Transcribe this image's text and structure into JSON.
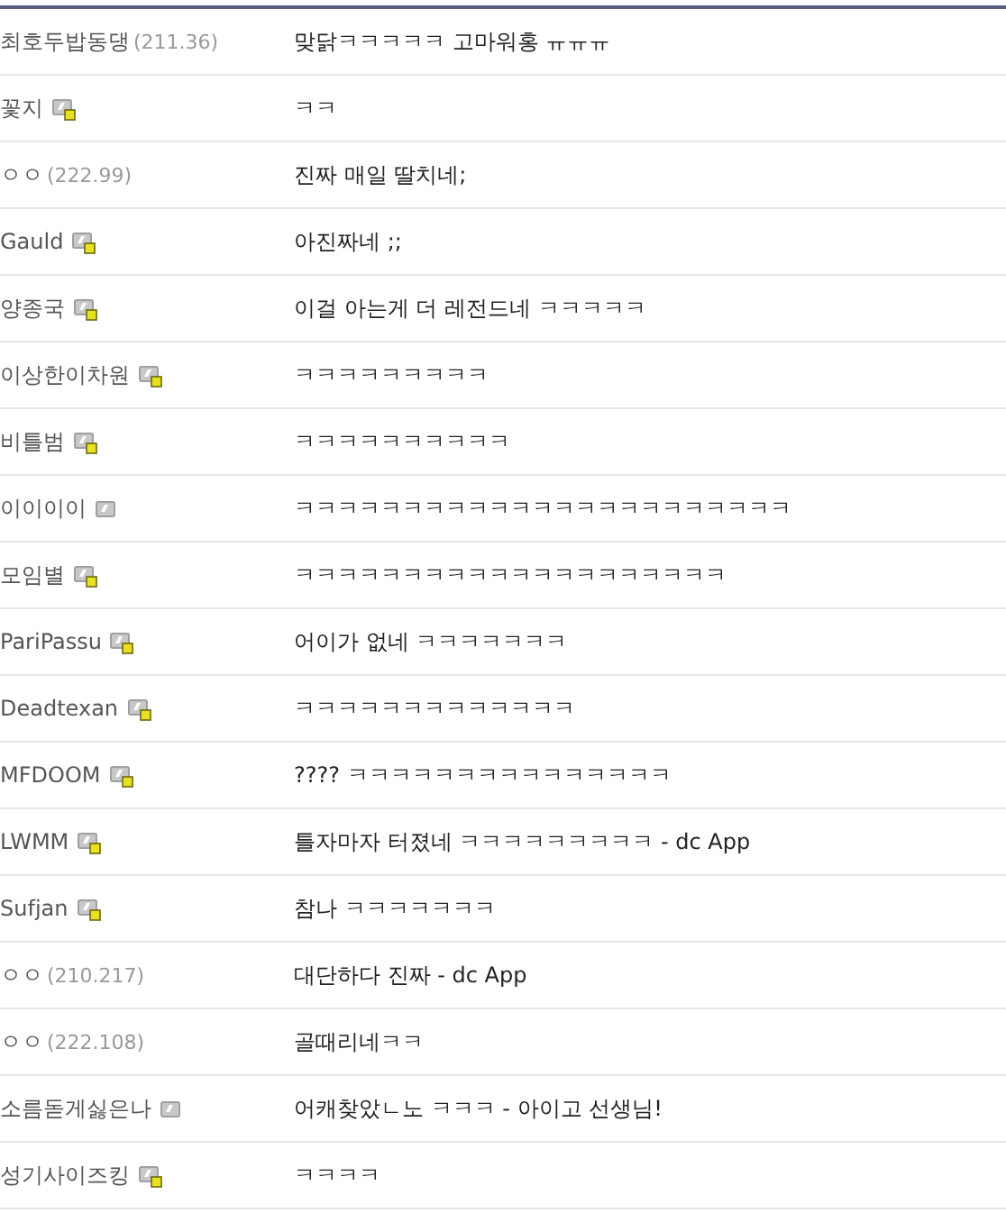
{
  "comments": [
    {
      "kind": "guest",
      "name": "최호두밥동댕",
      "ip": "(211.36)",
      "text": "맞닭ㅋㅋㅋㅋㅋ 고마워홍 ㅠㅠㅠ"
    },
    {
      "kind": "fixed",
      "name": "꽃지",
      "text": "ㅋㅋ"
    },
    {
      "kind": "guest",
      "name": "ㅇㅇ",
      "ip": "(222.99)",
      "text": "진짜 매일 딸치네;"
    },
    {
      "kind": "fixed",
      "name": "Gauld",
      "text": "아진짜네 ;;"
    },
    {
      "kind": "fixed",
      "name": "양종국",
      "text": "이걸 아는게 더 레전드네 ㅋㅋㅋㅋㅋ"
    },
    {
      "kind": "fixed",
      "name": "이상한이차원",
      "text": "ㅋㅋㅋㅋㅋㅋㅋㅋㅋ"
    },
    {
      "kind": "fixed",
      "name": "비틀범",
      "text": "ㅋㅋㅋㅋㅋㅋㅋㅋㅋㅋ"
    },
    {
      "kind": "half",
      "name": "이이이이",
      "text": "ㅋㅋㅋㅋㅋㅋㅋㅋㅋㅋㅋㅋㅋㅋㅋㅋㅋㅋㅋㅋㅋㅋㅋ"
    },
    {
      "kind": "fixed",
      "name": "모임별",
      "text": "ㅋㅋㅋㅋㅋㅋㅋㅋㅋㅋㅋㅋㅋㅋㅋㅋㅋㅋㅋㅋ"
    },
    {
      "kind": "fixed",
      "name": "PariPassu",
      "text": "어이가 없네 ㅋㅋㅋㅋㅋㅋㅋ"
    },
    {
      "kind": "fixed",
      "name": "Deadtexan",
      "text": "ㅋㅋㅋㅋㅋㅋㅋㅋㅋㅋㅋㅋㅋ"
    },
    {
      "kind": "fixed",
      "name": "MFDOOM",
      "text": "???? ㅋㅋㅋㅋㅋㅋㅋㅋㅋㅋㅋㅋㅋㅋㅋ"
    },
    {
      "kind": "fixed",
      "name": "LWMM",
      "text": "틀자마자 터졌네 ㅋㅋㅋㅋㅋㅋㅋㅋㅋ - dc App"
    },
    {
      "kind": "fixed",
      "name": "Sufjan",
      "text": "참나 ㅋㅋㅋㅋㅋㅋㅋ"
    },
    {
      "kind": "guest",
      "name": "ㅇㅇ",
      "ip": "(210.217)",
      "text": "대단하다 진짜 - dc App"
    },
    {
      "kind": "guest",
      "name": "ㅇㅇ",
      "ip": "(222.108)",
      "text": "골때리네ㅋㅋ"
    },
    {
      "kind": "half",
      "name": "소름돋게싫은나",
      "text": "어캐찾았ㄴ노 ㅋㅋㅋ - 아이고 선생님!"
    },
    {
      "kind": "fixed",
      "name": "성기사이즈킹",
      "text": "ㅋㅋㅋㅋ"
    }
  ]
}
